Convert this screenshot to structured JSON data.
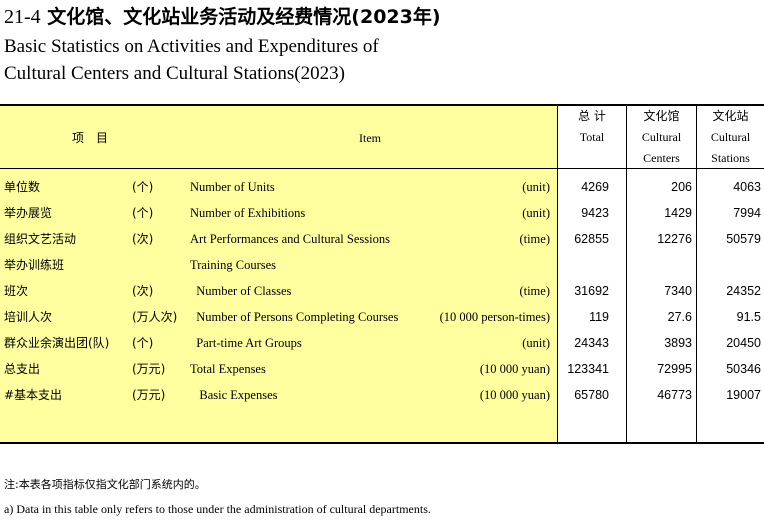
{
  "title": {
    "number": "21-4",
    "cn": "文化馆、文化站业务活动及经费情况(2023年)",
    "en_line1": "Basic Statistics on Activities and Expenditures of",
    "en_line2": "Cultural Centers and Cultural Stations(2023)"
  },
  "header": {
    "item_cn": "项　目",
    "item_en": "Item",
    "total_cn": "总 计",
    "total_en": "Total",
    "centers_cn": "文化馆",
    "centers_en1": "Cultural",
    "centers_en2": "Centers",
    "stations_cn": "文化站",
    "stations_en1": "Cultural",
    "stations_en2": "Stations"
  },
  "rows": [
    {
      "cn": "单位数",
      "unit_cn": "(个)",
      "en": "Number of Units",
      "unit_en": "(unit)",
      "total": "4269",
      "centers": "206",
      "stations": "4063"
    },
    {
      "cn": "举办展览",
      "unit_cn": "(个)",
      "en": "Number of Exhibitions",
      "unit_en": "(unit)",
      "total": "9423",
      "centers": "1429",
      "stations": "7994"
    },
    {
      "cn": "组织文艺活动",
      "unit_cn": "(次)",
      "en": "Art Performances and Cultural Sessions",
      "unit_en": "(time)",
      "total": "62855",
      "centers": "12276",
      "stations": "50579"
    },
    {
      "cn": "举办训练班",
      "unit_cn": "",
      "en": "Training Courses",
      "unit_en": "",
      "total": "",
      "centers": "",
      "stations": ""
    },
    {
      "cn": " 班次",
      "unit_cn": "(次)",
      "en": "  Number of Classes",
      "unit_en": "(time)",
      "total": "31692",
      "centers": "7340",
      "stations": "24352"
    },
    {
      "cn": " 培训人次",
      "unit_cn": "(万人次)",
      "en": "  Number of Persons Completing Courses",
      "unit_en": "(10 000 person-times)",
      "total": "119",
      "centers": "27.6",
      "stations": "91.5"
    },
    {
      "cn": "群众业余演出团(队)",
      "unit_cn": "(个)",
      "en": "  Part-time Art Groups",
      "unit_en": "(unit)",
      "total": "24343",
      "centers": "3893",
      "stations": "20450"
    },
    {
      "cn": "总支出",
      "unit_cn": "(万元)",
      "en": "Total Expenses",
      "unit_en": "(10 000 yuan)",
      "total": "123341",
      "centers": "72995",
      "stations": "50346"
    },
    {
      "cn": " #基本支出",
      "unit_cn": "(万元)",
      "en": "   Basic Expenses",
      "unit_en": "(10 000 yuan)",
      "total": "65780",
      "centers": "46773",
      "stations": "19007"
    }
  ],
  "notes": {
    "cn": "注:本表各项指标仅指文化部门系统内的。",
    "en": "a) Data in this table only refers to those under the administration of cultural departments."
  }
}
